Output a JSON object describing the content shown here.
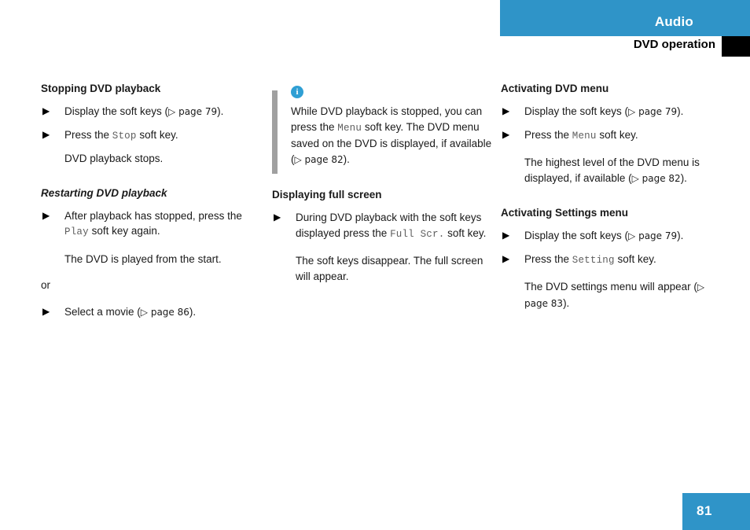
{
  "header": {
    "chapter_title": "Audio",
    "section_title": "DVD operation",
    "accent_color": "#2f94c8",
    "corner_color": "#000000"
  },
  "page": {
    "number": "81",
    "badge_color": "#2f94c8"
  },
  "columns": {
    "left": {
      "heading_1": "Stopping DVD playback",
      "step_1": "Display the soft keys (",
      "step_1_ref": "▷ page 79",
      "step_1_end": ").",
      "step_2_pre": "Press the ",
      "step_2_key": "Stop",
      "step_2_post": " soft key.",
      "result_1": "DVD playback stops.",
      "heading_2": "Restarting DVD playback",
      "step_3_pre": "After playback has stopped, press the ",
      "step_3_key": "Play",
      "step_3_post": " soft key again.",
      "result_2": "The DVD is played from the start.",
      "conjunction": "or",
      "step_4": "Select a movie (",
      "step_4_ref": "▷ page 86",
      "step_4_end": ")."
    },
    "middle": {
      "info_icon": "info-circle-icon",
      "info_line_1": "While DVD playback is stopped, you can press the ",
      "info_key": "Menu",
      "info_line_2": " soft key.",
      "info_line_3": "The DVD menu saved on the DVD is displayed, if available (",
      "info_ref": "▷ page 82",
      "info_line_4": ").",
      "heading_1": "Displaying full screen",
      "step_1_pre": "During DVD playback with the soft keys displayed press the ",
      "step_1_key": "Full Scr.",
      "step_1_post": " soft key.",
      "result_1": "The soft keys disappear. The full screen will appear."
    },
    "right": {
      "heading_1": "Activating DVD menu",
      "step_1": "Display the soft keys (",
      "step_1_ref": "▷ page 79",
      "step_1_end": ").",
      "step_2_pre": "Press the ",
      "step_2_key": "Menu",
      "step_2_post": " soft key.",
      "result_1": "The highest level of the DVD menu is displayed, if available (",
      "result_1_ref": "▷ page 82",
      "result_1_end": ").",
      "heading_2": "Activating Settings menu",
      "step_3": "Display the soft keys (",
      "step_3_ref": "▷ page 79",
      "step_3_end": ").",
      "step_4_pre": "Press the ",
      "step_4_key": "Setting",
      "step_4_post": " soft key.",
      "result_2": "The DVD settings menu will appear (",
      "result_2_ref": "▷ page 83",
      "result_2_end": ")."
    }
  },
  "icons": {
    "step_bullet": "▶",
    "cross_reference": "▷"
  }
}
